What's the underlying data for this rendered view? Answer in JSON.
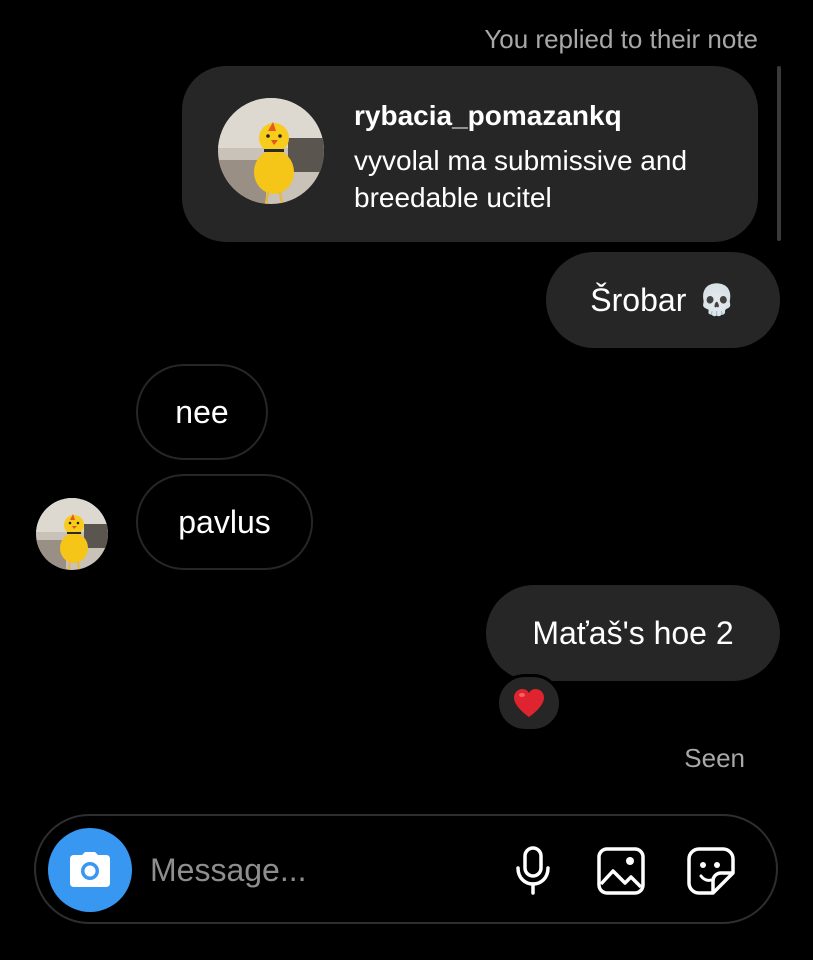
{
  "note_reply": {
    "caption": "You replied to their note",
    "username": "rybacia_pomazankq",
    "note_text": "vyvolal ma submissive and breedable ucitel"
  },
  "messages": [
    {
      "direction": "outgoing",
      "text": "Šrobar",
      "emoji": "💀"
    },
    {
      "direction": "incoming",
      "text": "nee"
    },
    {
      "direction": "incoming",
      "text": "pavlus"
    },
    {
      "direction": "outgoing",
      "text": "Maťaš's hoe 2",
      "reaction": "❤️"
    }
  ],
  "status": {
    "seen": "Seen"
  },
  "composer": {
    "placeholder": "Message...",
    "icons": [
      "camera-icon",
      "microphone-icon",
      "gallery-icon",
      "sticker-icon"
    ],
    "camera_color": "#3897f0"
  },
  "colors": {
    "background": "#000000",
    "bubble": "#262626",
    "secondary_text": "#a8a8a8"
  }
}
